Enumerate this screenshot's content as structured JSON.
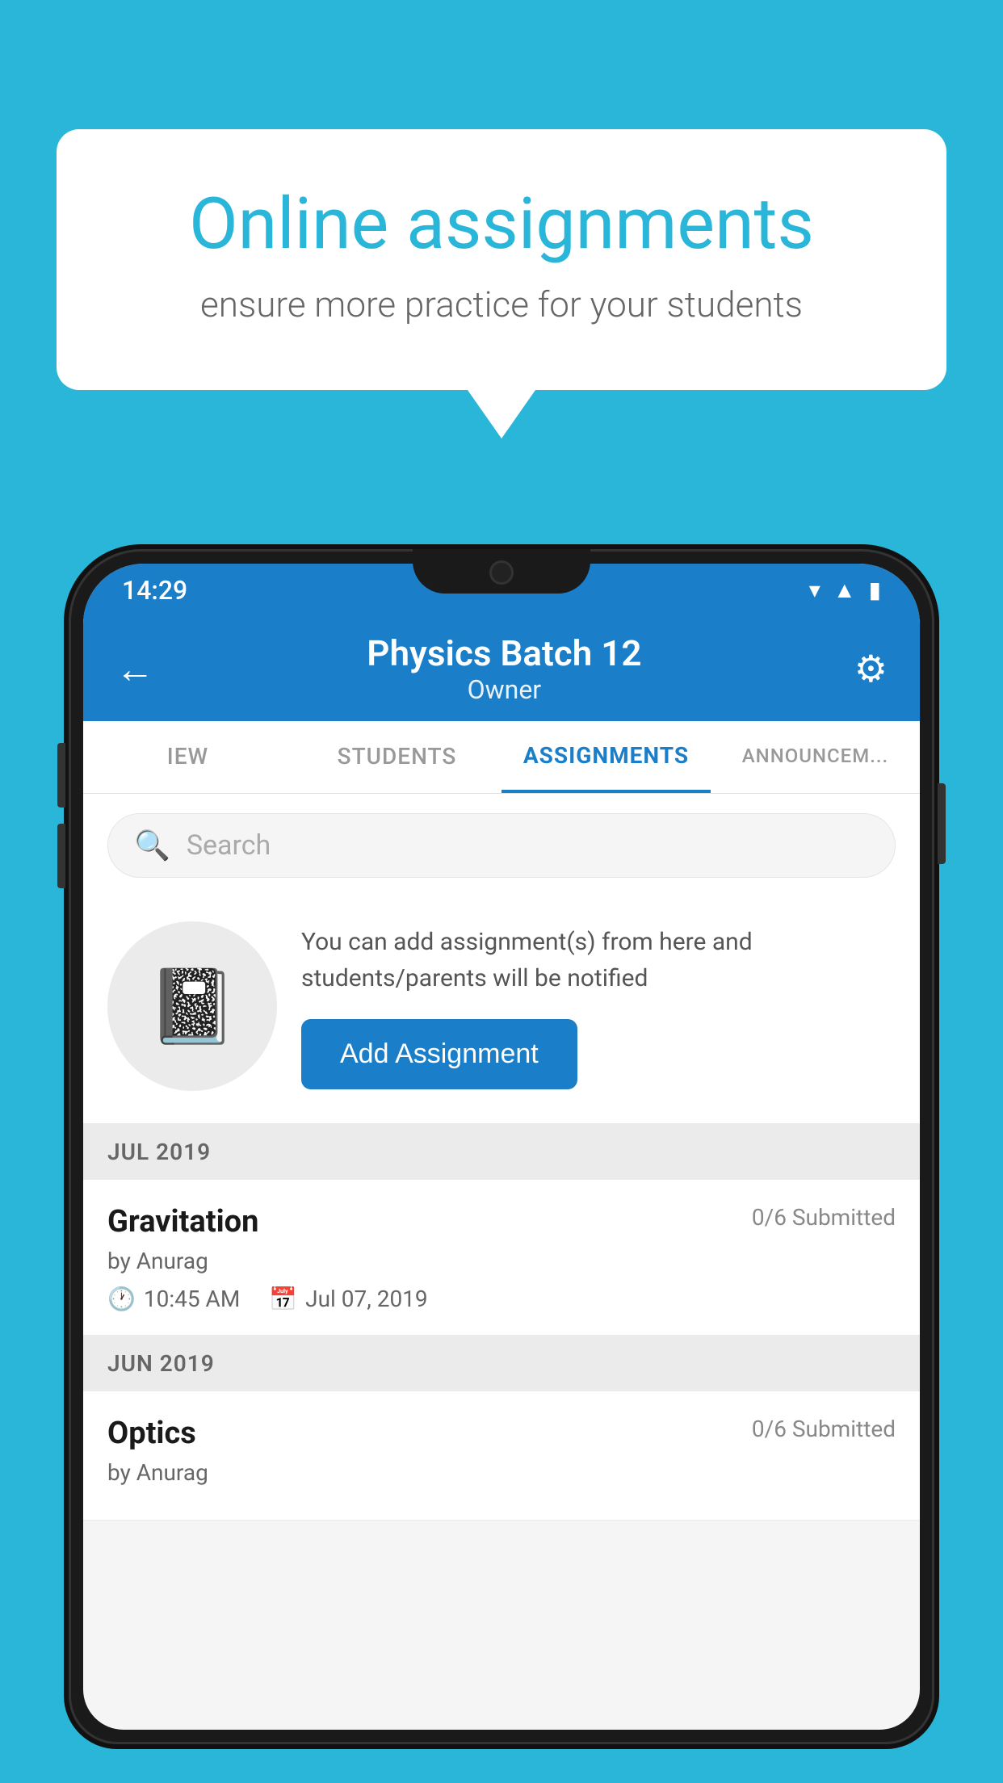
{
  "background_color": "#29b6d8",
  "speech_bubble": {
    "title": "Online assignments",
    "subtitle": "ensure more practice for your students"
  },
  "status_bar": {
    "time": "14:29",
    "icons": [
      "wifi",
      "signal",
      "battery"
    ]
  },
  "header": {
    "title": "Physics Batch 12",
    "subtitle": "Owner",
    "back_label": "←",
    "settings_label": "⚙"
  },
  "tabs": [
    {
      "label": "IEW",
      "active": false
    },
    {
      "label": "STUDENTS",
      "active": false
    },
    {
      "label": "ASSIGNMENTS",
      "active": true
    },
    {
      "label": "ANNOUNCEM...",
      "active": false
    }
  ],
  "search": {
    "placeholder": "Search"
  },
  "promo": {
    "description": "You can add assignment(s) from here and students/parents will be notified",
    "button_label": "Add Assignment"
  },
  "sections": [
    {
      "month_label": "JUL 2019",
      "assignments": [
        {
          "name": "Gravitation",
          "submitted": "0/6 Submitted",
          "by": "by Anurag",
          "time": "10:45 AM",
          "date": "Jul 07, 2019"
        }
      ]
    },
    {
      "month_label": "JUN 2019",
      "assignments": [
        {
          "name": "Optics",
          "submitted": "0/6 Submitted",
          "by": "by Anurag",
          "time": "",
          "date": ""
        }
      ]
    }
  ]
}
